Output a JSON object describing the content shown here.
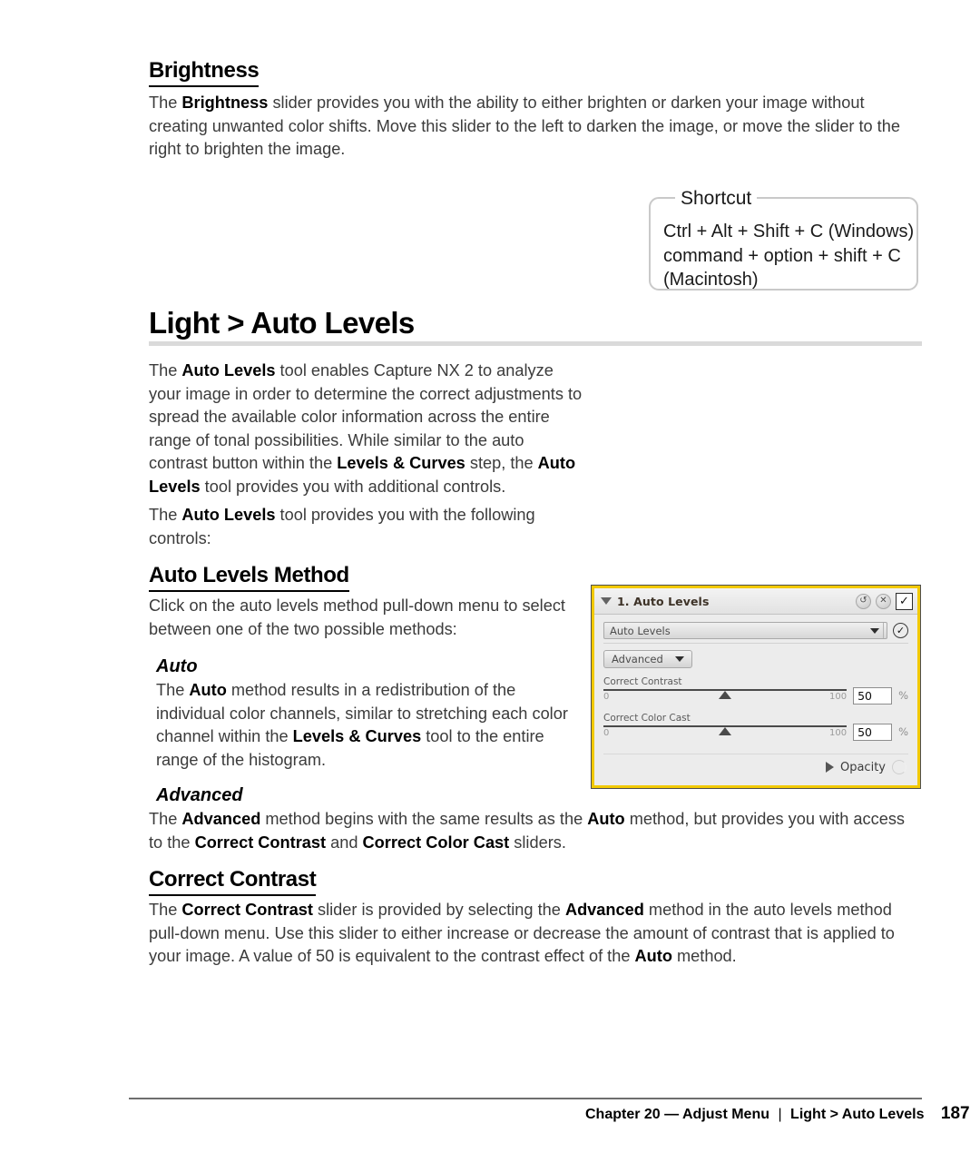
{
  "sections": {
    "brightness": {
      "heading": "Brightness",
      "paragraph_html": "The <b>Brightness</b> slider provides you with the ability to either brighten or darken your image without creating unwanted color shifts. Move this slider to the left to darken the image, or move the slider to the right to brighten the image."
    },
    "shortcut": {
      "legend": "Shortcut",
      "line1": "Ctrl + Alt + Shift + C (Windows)",
      "line2": "command + option + shift + C",
      "line3": "(Macintosh)"
    },
    "auto_levels": {
      "heading": "Light > Auto Levels",
      "paragraph1_html": "The <b>Auto Levels</b> tool enables Capture NX 2 to analyze your image in order to determine the correct adjustments to spread the available color information across the entire range of tonal possibilities. While similar to the auto contrast button within the <b>Levels &amp; Curves</b> step, the <b>Auto Levels</b> tool provides you with additional controls.",
      "paragraph2_html": "The <b>Auto Levels</b> tool provides you with the following controls:"
    },
    "auto_levels_method": {
      "heading": "Auto Levels Method",
      "paragraph_html": "Click on the auto levels method pull-down menu to select between one of the two possible methods:",
      "auto": {
        "heading": "Auto",
        "paragraph_html": "The <b>Auto</b> method results in a redistribution of the individual color channels, similar to stretching each color channel within the <b>Levels &amp; Curves</b> tool to the entire range of the histogram."
      },
      "advanced": {
        "heading": "Advanced",
        "paragraph_html": "The <b>Advanced</b> method begins with the same results as the <b>Auto</b> method, but provides you with access to the <b>Correct Contrast</b> and <b>Correct Color Cast</b> sliders."
      }
    },
    "correct_contrast": {
      "heading": "Correct Contrast",
      "paragraph_html": "The <b>Correct Contrast</b> slider is provided by selecting the <b>Advanced</b> method in the auto levels method pull-down menu. Use this slider to either increase or decrease the amount of contrast that is applied to your image. A value of 50 is equivalent to the contrast effect of the <b>Auto</b> method."
    }
  },
  "panel": {
    "border_color": "#f2c900",
    "title": "1. Auto Levels",
    "header_icons": {
      "reset": "↺",
      "close": "✕",
      "apply": "✓"
    },
    "method_select": {
      "value": "Auto Levels",
      "arrow": "▼",
      "check": "✓"
    },
    "mode_button": {
      "value": "Advanced",
      "arrow": "▼"
    },
    "sliders": [
      {
        "label": "Correct Contrast",
        "min": "0",
        "max": "100",
        "value": "50",
        "unit": "%",
        "percent": 50
      },
      {
        "label": "Correct Color Cast",
        "min": "0",
        "max": "100",
        "value": "50",
        "unit": "%",
        "percent": 50
      }
    ],
    "opacity": {
      "label": "Opacity",
      "arrow": "▶"
    }
  },
  "footer": {
    "chapter": "Chapter 20 — Adjust Menu",
    "separator": "|",
    "topic": "Light > Auto Levels",
    "page": "187"
  }
}
